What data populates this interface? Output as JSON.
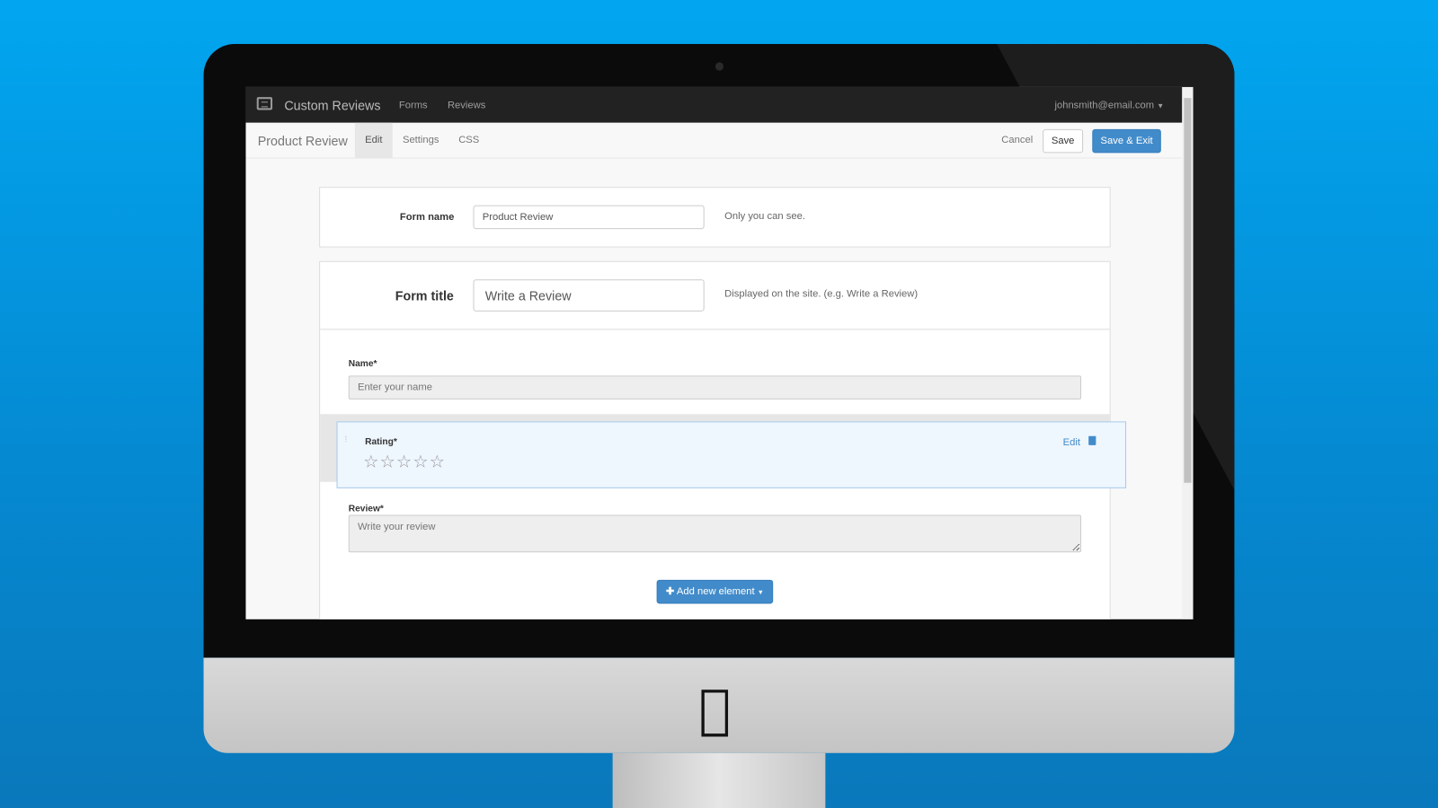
{
  "navbar": {
    "brand": "Custom Reviews",
    "links": [
      "Forms",
      "Reviews"
    ],
    "user": "johnsmith@email.com"
  },
  "subnav": {
    "title": "Product Review",
    "tabs": [
      "Edit",
      "Settings",
      "CSS"
    ],
    "active_tab": "Edit",
    "cancel": "Cancel",
    "save": "Save",
    "save_exit": "Save & Exit"
  },
  "form_name": {
    "label": "Form name",
    "value": "Product Review",
    "help": "Only you can see."
  },
  "form_title": {
    "label": "Form title",
    "value": "Write a Review",
    "help": "Displayed on the site. (e.g. Write a Review)"
  },
  "fields": {
    "name": {
      "label": "Name*",
      "placeholder": "Enter your name"
    },
    "rating": {
      "label": "Rating*",
      "stars": "☆☆☆☆☆",
      "edit": "Edit",
      "rating_value": 0,
      "rating_max": 5
    },
    "review": {
      "label": "Review*",
      "placeholder": "Write your review"
    }
  },
  "add_element": "Add new element",
  "colors": {
    "primary": "#428bca",
    "navbar": "#222222",
    "highlight": "#eef6fe"
  }
}
